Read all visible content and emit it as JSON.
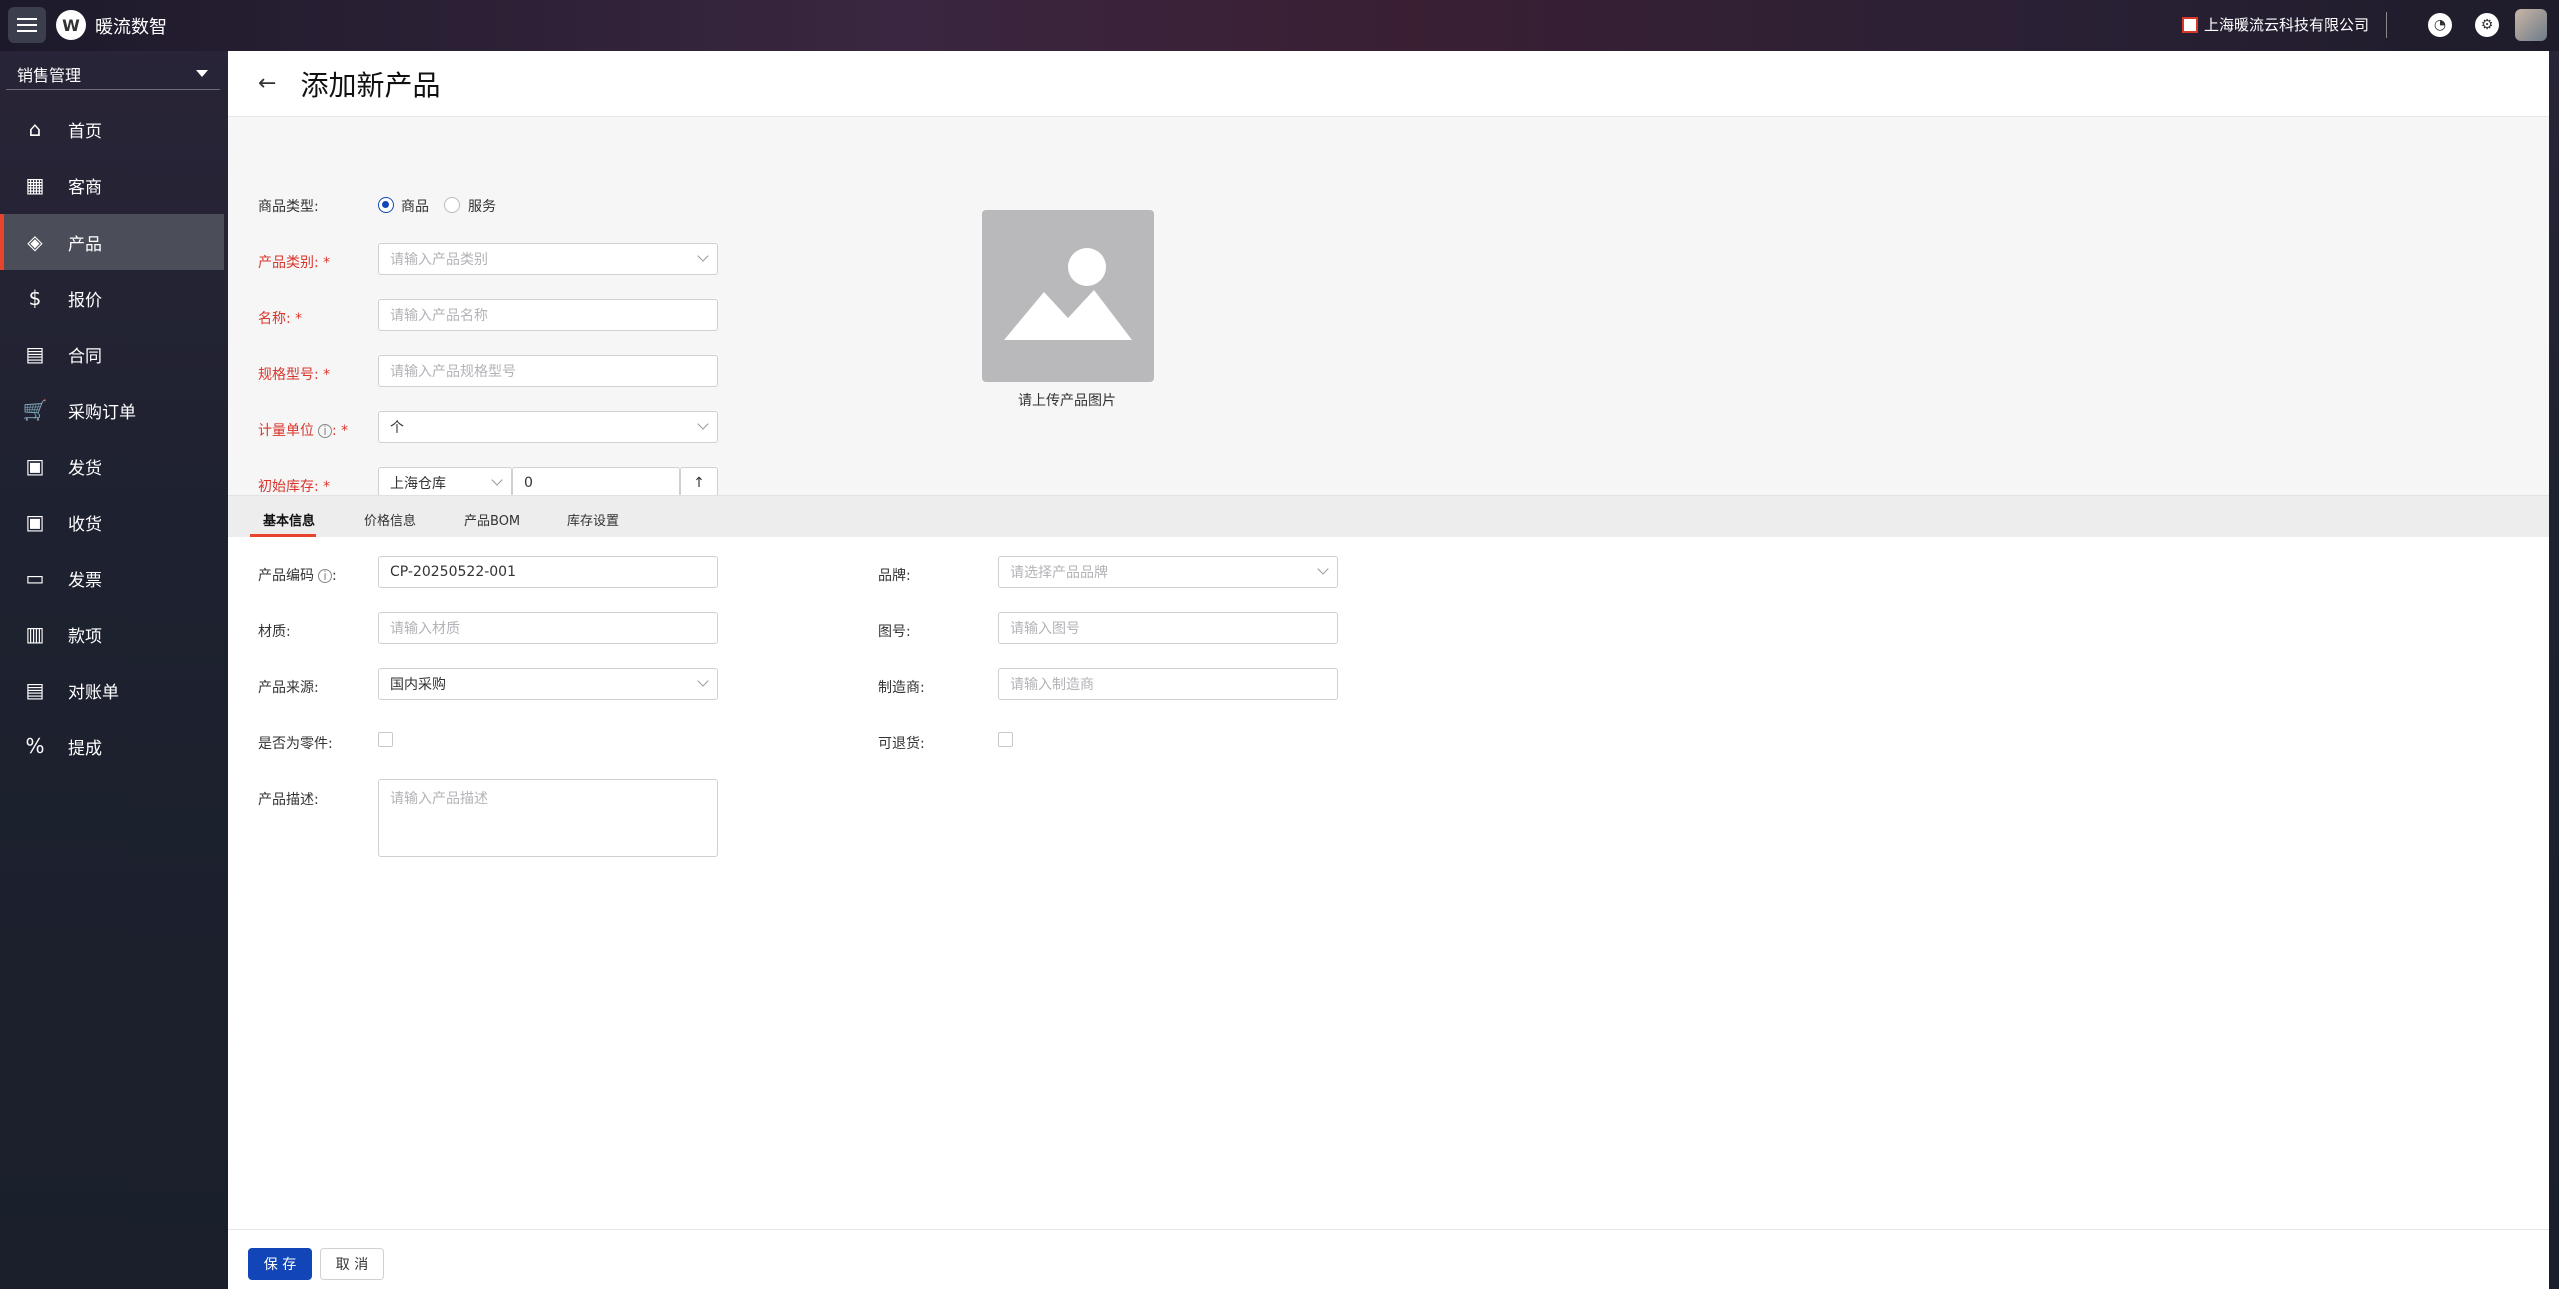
{
  "app": {
    "title": "暖流数智",
    "logo_text": "W"
  },
  "topbar": {
    "company": "上海暖流云科技有限公司",
    "icons": [
      "notification-icon",
      "settings-icon"
    ]
  },
  "sidebar": {
    "module": "销售管理",
    "items": [
      {
        "label": "首页",
        "icon": "⌂"
      },
      {
        "label": "客商",
        "icon": "▦"
      },
      {
        "label": "产品",
        "icon": "◈"
      },
      {
        "label": "报价",
        "icon": "$"
      },
      {
        "label": "合同",
        "icon": "▤"
      },
      {
        "label": "采购订单",
        "icon": "🛒"
      },
      {
        "label": "发货",
        "icon": "▣"
      },
      {
        "label": "收货",
        "icon": "▣"
      },
      {
        "label": "发票",
        "icon": "▭"
      },
      {
        "label": "款项",
        "icon": "▥"
      },
      {
        "label": "对账单",
        "icon": "▤"
      },
      {
        "label": "提成",
        "icon": "%"
      }
    ]
  },
  "page": {
    "back": "←",
    "title": "添加新产品"
  },
  "top_form": {
    "type_label": "商品类型:",
    "type_options": [
      "商品",
      "服务"
    ],
    "category_label": "产品类别:",
    "category_placeholder": "请输入产品类别",
    "name_label": "名称:",
    "name_placeholder": "请输入产品名称",
    "spec_label": "规格型号:",
    "spec_placeholder": "请输入产品规格型号",
    "unit_label": "计量单位",
    "unit_value": "个",
    "stock_label": "初始库存:",
    "warehouse_value": "上海仓库",
    "stock_value": "0",
    "required_mark": "*",
    "image_caption": "请上传产品图片"
  },
  "tabs": [
    "基本信息",
    "价格信息",
    "产品BOM",
    "库存设置"
  ],
  "basic": {
    "code_label": "产品编码",
    "code_value": "CP-20250522-001",
    "brand_label": "品牌:",
    "brand_placeholder": "请选择产品品牌",
    "material_label": "材质:",
    "material_placeholder": "请输入材质",
    "drawing_label": "图号:",
    "drawing_placeholder": "请输入图号",
    "source_label": "产品来源:",
    "source_value": "国内采购",
    "maker_label": "制造商:",
    "maker_placeholder": "请输入制造商",
    "part_label": "是否为零件:",
    "returnable_label": "可退货:",
    "desc_label": "产品描述:",
    "desc_placeholder": "请输入产品描述"
  },
  "footer": {
    "save": "保 存",
    "cancel": "取 消"
  },
  "colors": {
    "primary": "#1246b8",
    "accent": "#e8442d",
    "required": "#d9362c"
  }
}
